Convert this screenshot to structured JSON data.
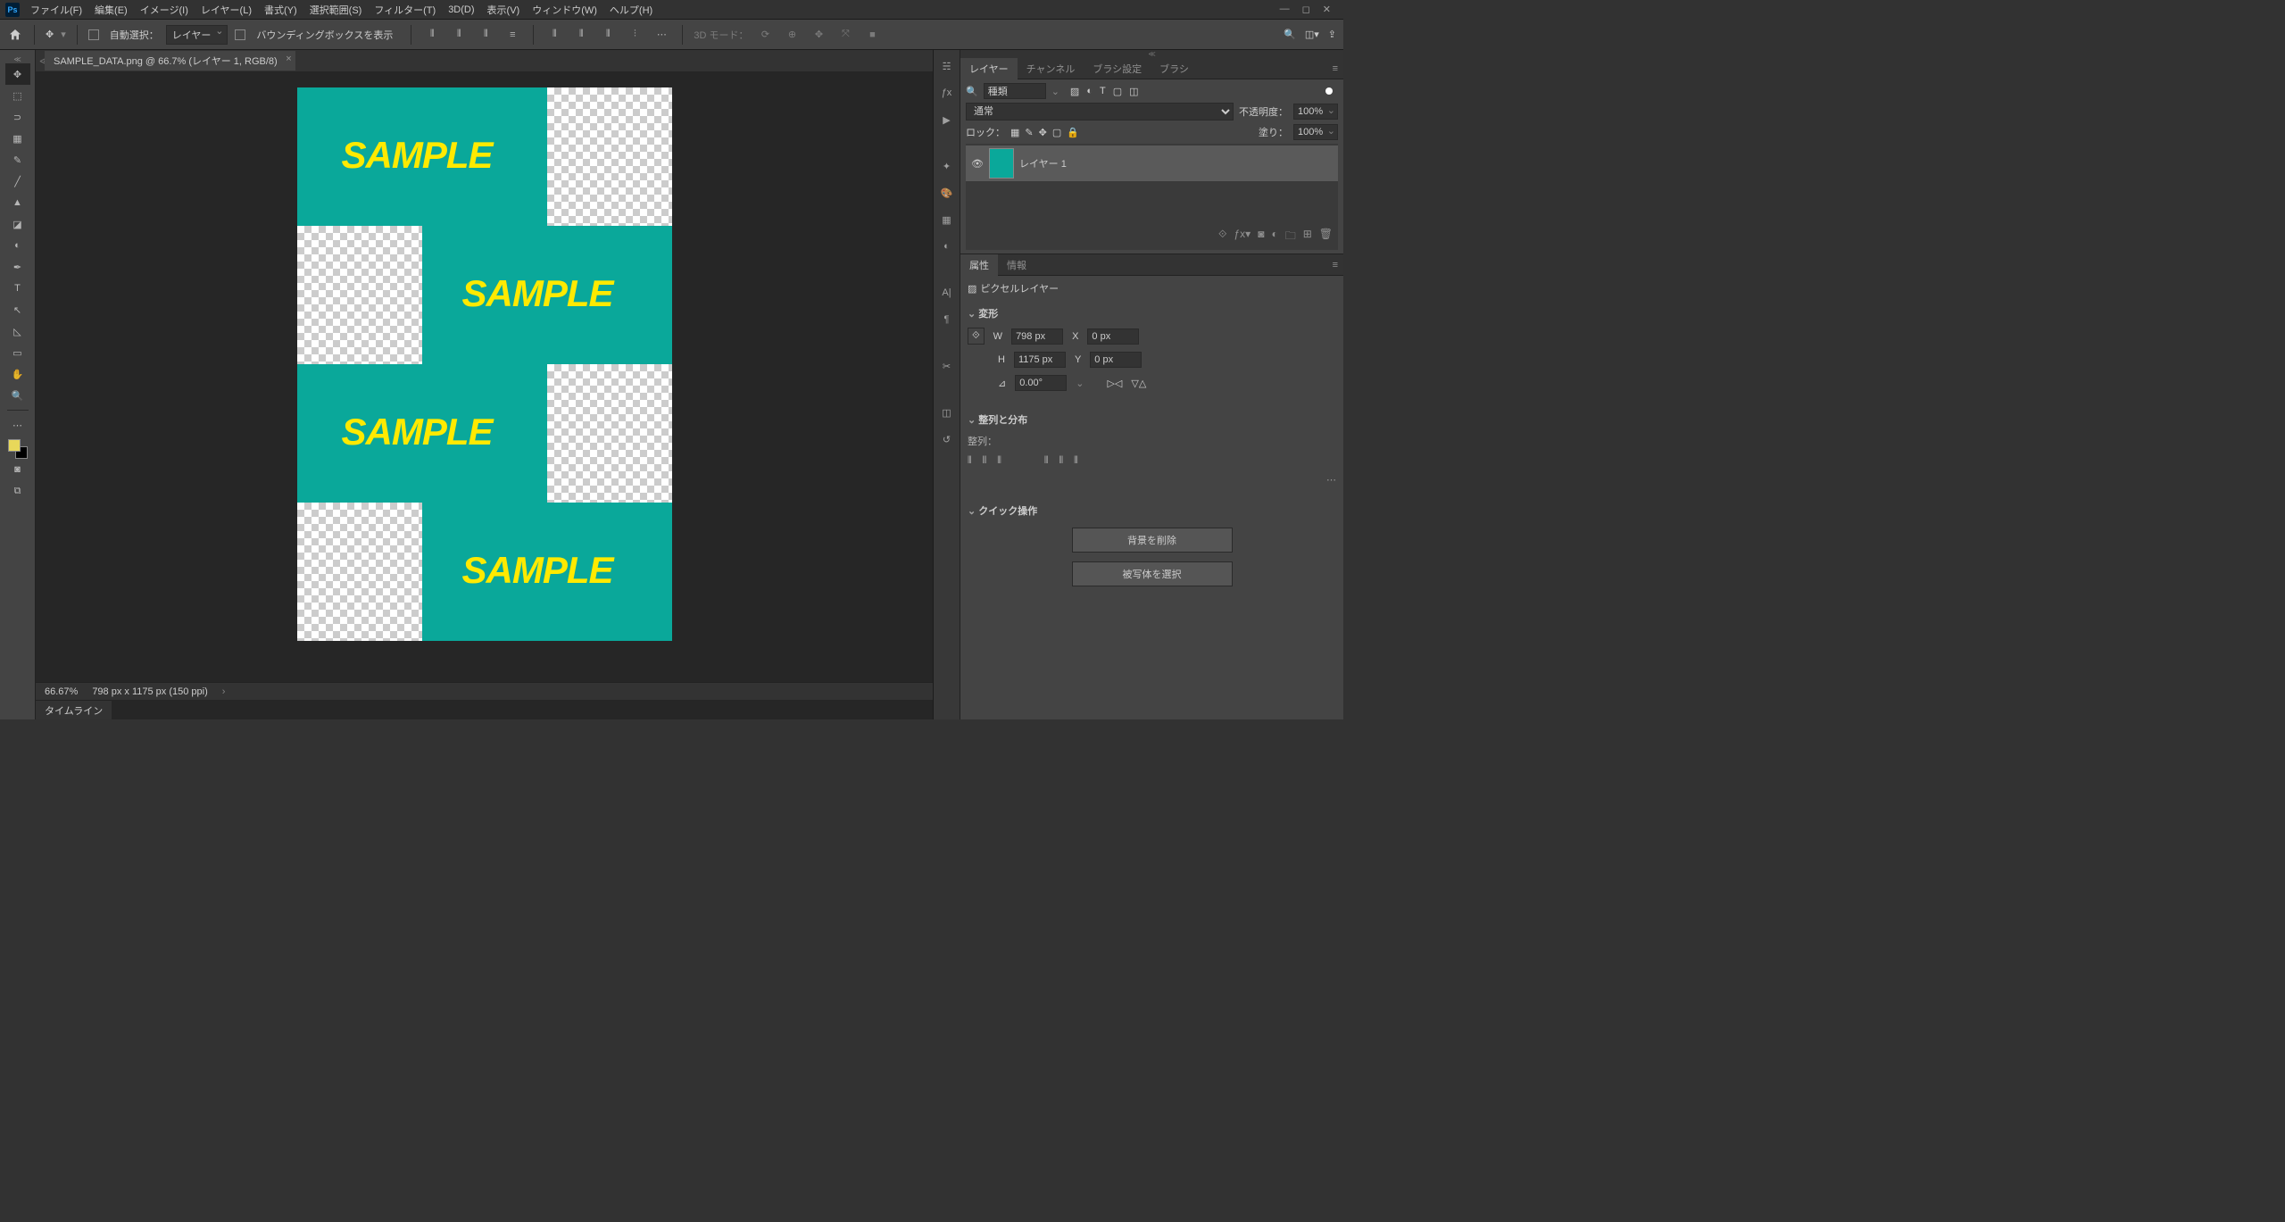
{
  "menu": {
    "items": [
      "ファイル(F)",
      "編集(E)",
      "イメージ(I)",
      "レイヤー(L)",
      "書式(Y)",
      "選択範囲(S)",
      "フィルター(T)",
      "3D(D)",
      "表示(V)",
      "ウィンドウ(W)",
      "ヘルプ(H)"
    ]
  },
  "options": {
    "auto_select_label": "自動選択：",
    "auto_select_target": "レイヤー",
    "bbox_label": "バウンディングボックスを表示",
    "three_d_mode": "3D モード："
  },
  "tab": {
    "title": "SAMPLE_DATA.png @ 66.7% (レイヤー 1, RGB/8)"
  },
  "canvas": {
    "text": "SAMPLE"
  },
  "status": {
    "zoom": "66.67%",
    "dims": "798 px x 1175 px (150 ppi)"
  },
  "timeline": {
    "label": "タイムライン"
  },
  "layers_panel": {
    "tabs": [
      "レイヤー",
      "チャンネル",
      "ブラシ設定",
      "ブラシ"
    ],
    "search_label": "種類",
    "blend_mode": "通常",
    "opacity_label": "不透明度：",
    "opacity_value": "100%",
    "lock_label": "ロック：",
    "fill_label": "塗り：",
    "fill_value": "100%",
    "layer_name": "レイヤー 1"
  },
  "props_panel": {
    "tabs": [
      "属性",
      "情報"
    ],
    "kind": "ピクセルレイヤー",
    "transform_head": "変形",
    "W_label": "W",
    "W_val": "798 px",
    "H_label": "H",
    "H_val": "1175 px",
    "X_label": "X",
    "X_val": "0 px",
    "Y_label": "Y",
    "Y_val": "0 px",
    "angle_val": "0.00°",
    "align_head": "整列と分布",
    "align_sub": "整列：",
    "quick_head": "クイック操作",
    "btn_remove_bg": "背景を削除",
    "btn_select_subject": "被写体を選択"
  }
}
